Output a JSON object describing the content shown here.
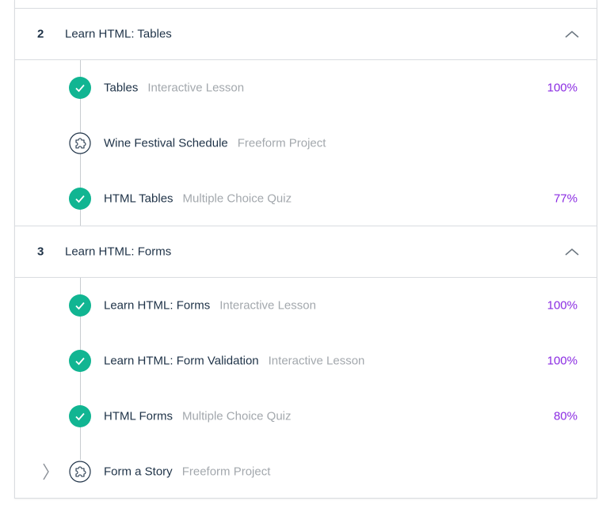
{
  "colors": {
    "complete": "#11b592",
    "progress": "#8a2be2",
    "title": "#1e3247",
    "muted": "#a3a8ad",
    "border": "#d9dce0"
  },
  "sections": [
    {
      "number": "2",
      "title": "Learn HTML: Tables",
      "toggle_icon": "chevron-up-icon",
      "items": [
        {
          "title": "Tables",
          "type": "Interactive Lesson",
          "progress": "100%",
          "status": "complete",
          "icon": "checkmark-icon"
        },
        {
          "title": "Wine Festival Schedule",
          "type": "Freeform Project",
          "progress": "",
          "status": "project",
          "icon": "puzzle-icon"
        },
        {
          "title": "HTML Tables",
          "type": "Multiple Choice Quiz",
          "progress": "77%",
          "status": "complete",
          "icon": "checkmark-icon"
        }
      ]
    },
    {
      "number": "3",
      "title": "Learn HTML: Forms",
      "toggle_icon": "chevron-up-icon",
      "items": [
        {
          "title": "Learn HTML: Forms",
          "type": "Interactive Lesson",
          "progress": "100%",
          "status": "complete",
          "icon": "checkmark-icon"
        },
        {
          "title": "Learn HTML: Form Validation",
          "type": "Interactive Lesson",
          "progress": "100%",
          "status": "complete",
          "icon": "checkmark-icon"
        },
        {
          "title": "HTML Forms",
          "type": "Multiple Choice Quiz",
          "progress": "80%",
          "status": "complete",
          "icon": "checkmark-icon"
        },
        {
          "title": "Form a Story",
          "type": "Freeform Project",
          "progress": "",
          "status": "project",
          "icon": "puzzle-icon",
          "expand_icon": "chevron-right-icon"
        }
      ]
    }
  ]
}
